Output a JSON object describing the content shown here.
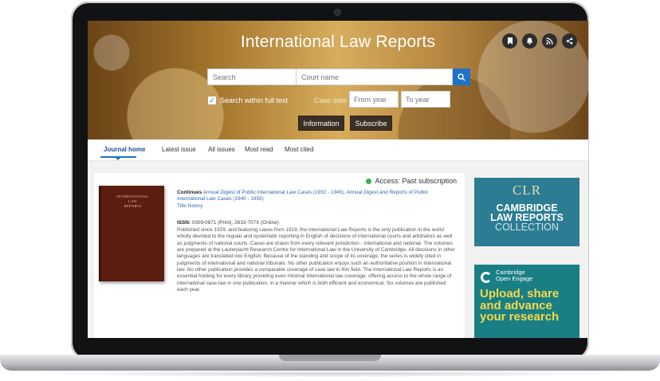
{
  "journal": {
    "title": "International Law Reports",
    "icons": [
      "bookmark-icon",
      "bell-icon",
      "rss-icon",
      "share-icon"
    ]
  },
  "search": {
    "placeholder": "Search",
    "court_placeholder": "Court name",
    "fulltext_label": "Search within full text",
    "case_date_label": "Case date",
    "from_year_placeholder": "From year",
    "to_year_placeholder": "To year"
  },
  "buttons": {
    "information": "Information",
    "subscribe": "Subscribe"
  },
  "tabs": [
    {
      "label": "Journal home",
      "active": true
    },
    {
      "label": "Latest issue"
    },
    {
      "label": "All issues"
    },
    {
      "label": "Most read"
    },
    {
      "label": "Most cited"
    }
  ],
  "access": {
    "label": "Access: Past subscription",
    "color": "#3cae4d"
  },
  "cover": {
    "line1": "INTERNATIONAL",
    "line2": "LAW",
    "line3": "REPORTS"
  },
  "details": {
    "continues_label": "Continues",
    "continues_text": "Annual Digest of Public International Law Cases (1932 - 1945), Annual Digest and Reports of Public International Law Cases (1940 - 1955)",
    "title_history": "Title history",
    "issn_label": "ISSN:",
    "issn_value": "0309-0671 (Print), 2633-707X (Online)",
    "description": "Published since 1929, and featuring cases from 1919, the International Law Reports is the only publication in the world wholly devoted to the regular and systematic reporting in English of decisions of international courts and arbitrators as well as judgments of national courts. Cases are drawn from every relevant jurisdiction - international and national. The volumes are prepared at the Lauterpacht Research Centre for International Law in the University of Cambridge. All decisions in other languages are translated into English. Because of the standing and scope of its coverage, the series is widely cited in judgments of international and national tribunals. No other publication enjoys such an authoritative position in international law. No other publication provides a comparable coverage of case law in this field. The International Law Reports is an essential holding for every library providing even minimal international law coverage, offering access to the whole range of international case law in one publication, in a manner which is both efficient and economical. Six volumes are published each year."
  },
  "ads": {
    "cup_mark": "CLR",
    "cup_line1": "CAMBRIDGE",
    "cup_line2": "LAW REPORTS",
    "cup_line3": "COLLECTION",
    "coe_line1": "Cambridge",
    "coe_line2": "Open Engage",
    "coe_cta1": "Upload, share",
    "coe_cta2": "and advance",
    "coe_cta3": "your research"
  },
  "colors": {
    "accent": "#1d73c8",
    "link": "#2f67b1",
    "button_dark": "#3b3026",
    "cup_ad": "#2c7d94",
    "coe_ad": "#1a7f84",
    "coe_text": "#f6d84a"
  }
}
